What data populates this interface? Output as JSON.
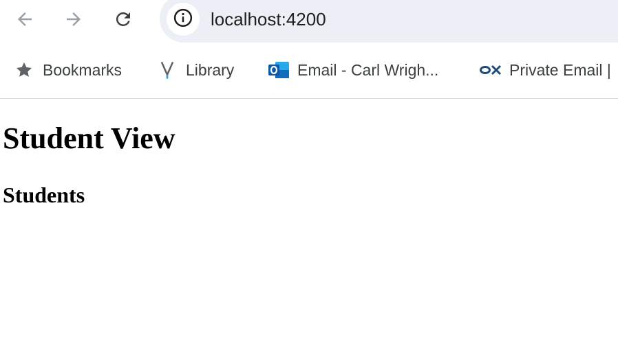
{
  "browser": {
    "url": "localhost:4200",
    "bookmarks": [
      {
        "label": "Bookmarks",
        "icon": "star-icon"
      },
      {
        "label": "Library",
        "icon": "library-v-icon"
      },
      {
        "label": "Email - Carl Wrigh...",
        "icon": "outlook-icon"
      },
      {
        "label": "Private Email |",
        "icon": "ox-icon"
      }
    ]
  },
  "page": {
    "title": "Student View",
    "subtitle": "Students"
  },
  "colors": {
    "omnibox_bg": "#eceff6",
    "icon_gray": "#5f6368",
    "disabled_gray": "#9aa0a6",
    "outlook_blue": "#0f6cbd",
    "ox_navy": "#1e4a7a"
  }
}
